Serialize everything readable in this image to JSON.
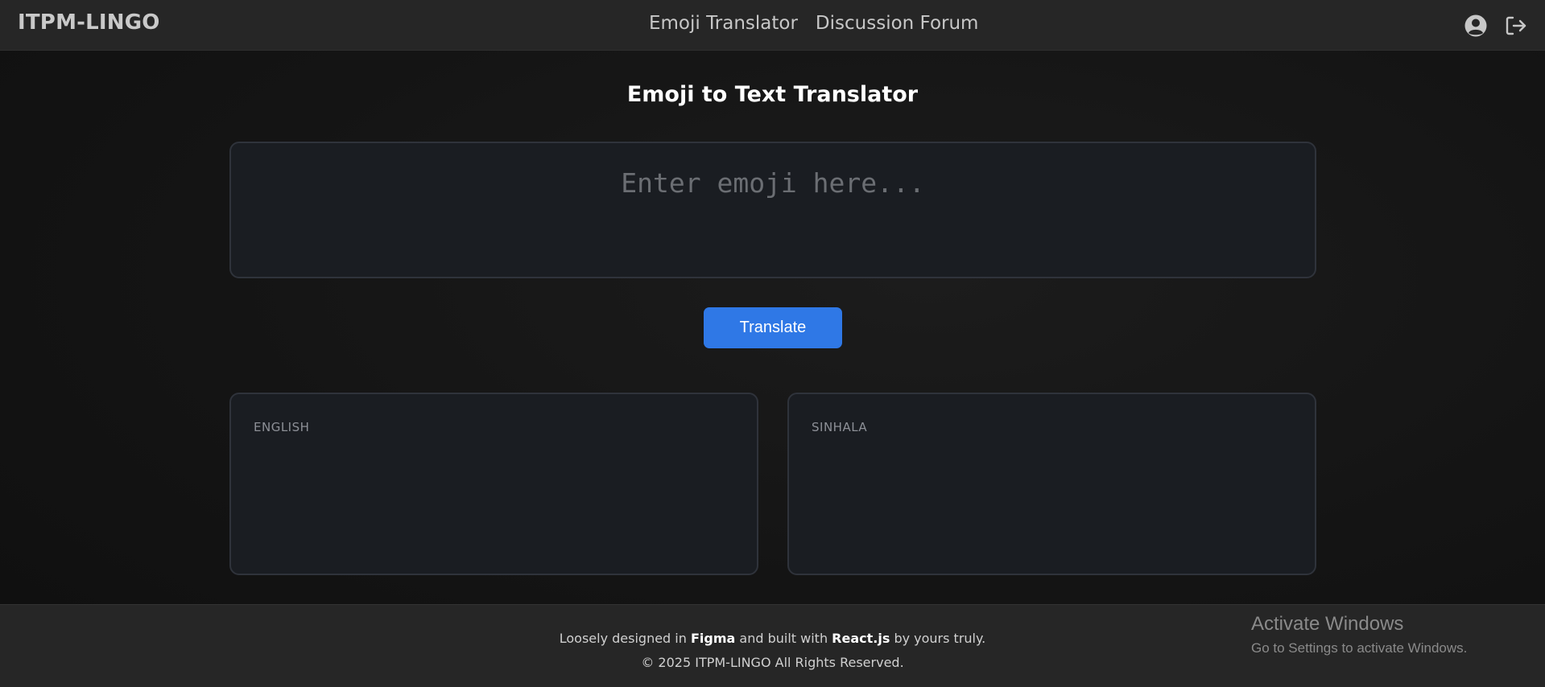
{
  "navbar": {
    "brand": "ITPM-LINGO",
    "links": [
      "Emoji Translator",
      "Discussion Forum"
    ],
    "icons": [
      "user-circle-icon",
      "logout-icon"
    ]
  },
  "main": {
    "title": "Emoji to Text Translator",
    "input": {
      "value": "",
      "placeholder": "Enter emoji here..."
    },
    "translate_label": "Translate",
    "outputs": [
      {
        "label": "ENGLISH",
        "value": ""
      },
      {
        "label": "SINHALA",
        "value": ""
      }
    ]
  },
  "footer": {
    "line1_prefix": "Loosely designed in ",
    "line1_tool1": "Figma",
    "line1_mid": " and built with ",
    "line1_tool2": "React.js",
    "line1_suffix": " by yours truly.",
    "line2": "© 2025 ITPM-LINGO All Rights Reserved."
  },
  "watermark": {
    "title": "Activate Windows",
    "subtitle": "Go to Settings to activate Windows."
  },
  "colors": {
    "accent": "#2f78e6",
    "navbar_bg": "#262626",
    "card_bg": "#1a1d22"
  }
}
